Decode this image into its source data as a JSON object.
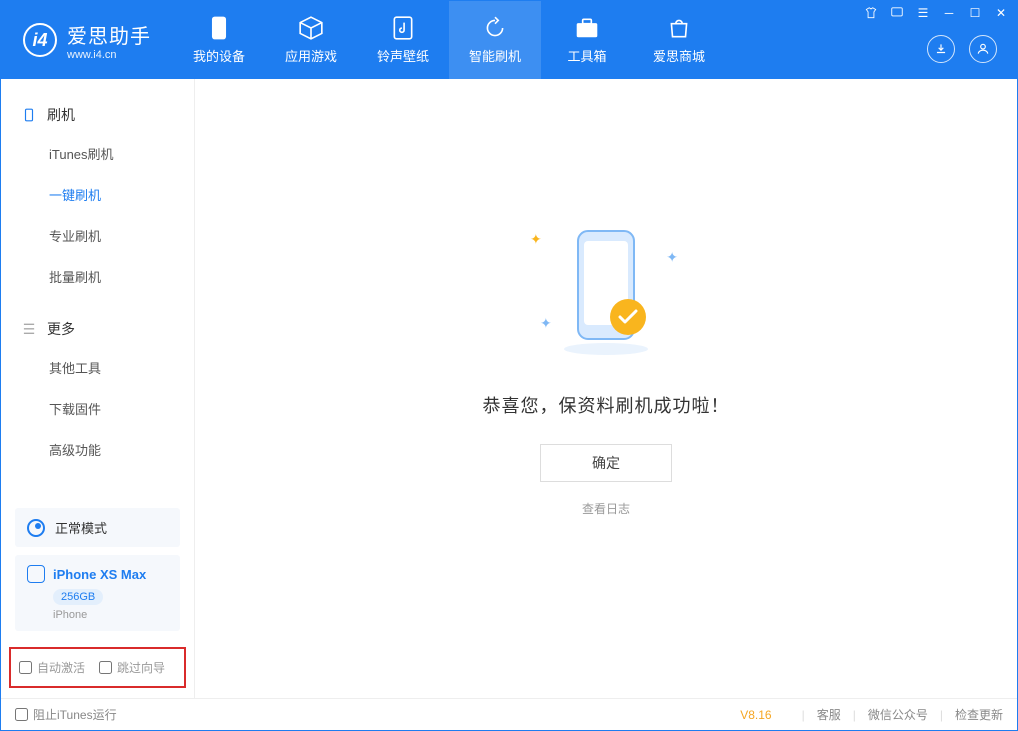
{
  "app": {
    "name_cn": "爱思助手",
    "name_en": "www.i4.cn"
  },
  "nav": {
    "my_device": "我的设备",
    "apps_games": "应用游戏",
    "ringtone_wallpaper": "铃声壁纸",
    "smart_flash": "智能刷机",
    "toolbox": "工具箱",
    "store": "爱思商城"
  },
  "sidebar": {
    "section_flash": "刷机",
    "items_flash": {
      "itunes_flash": "iTunes刷机",
      "oneclick_flash": "一键刷机",
      "pro_flash": "专业刷机",
      "batch_flash": "批量刷机"
    },
    "section_more": "更多",
    "items_more": {
      "other_tools": "其他工具",
      "download_firmware": "下载固件",
      "advanced": "高级功能"
    },
    "mode_label": "正常模式",
    "device": {
      "name": "iPhone XS Max",
      "capacity": "256GB",
      "type": "iPhone"
    },
    "footer_checks": {
      "auto_activate": "自动激活",
      "skip_guide": "跳过向导"
    }
  },
  "main": {
    "success_title": "恭喜您，保资料刷机成功啦！",
    "confirm_btn": "确定",
    "view_log": "查看日志"
  },
  "footer": {
    "block_itunes": "阻止iTunes运行",
    "version": "V8.16",
    "customer_service": "客服",
    "wechat": "微信公众号",
    "check_update": "检查更新"
  }
}
